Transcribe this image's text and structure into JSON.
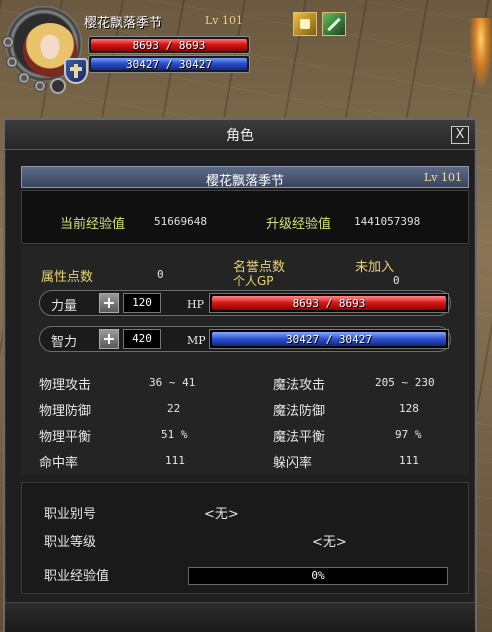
{
  "hud": {
    "name": "樱花飘落季节",
    "level": "Lv 101",
    "hp_text": "8693 / 8693",
    "mp_text": "30427 / 30427",
    "buffs": [
      "book-buff-icon",
      "sword-buff-icon"
    ]
  },
  "window": {
    "title": "角色",
    "close_label": "X",
    "char_name": "樱花飘落季节",
    "char_level": "Lv 101",
    "exp": {
      "current_label": "当前经验值",
      "current_value": "51669648",
      "next_label": "升级经验值",
      "next_value": "1441057398"
    },
    "attr_points_label": "属性点数",
    "attr_points_value": "0",
    "honor_label": "名誉点数",
    "honor_value": "未加入",
    "gp_label": "个人GP",
    "gp_value": "0",
    "str": {
      "label": "力量",
      "value": "120",
      "bar_label": "HP",
      "bar_text": "8693 / 8693",
      "fill": 1.0
    },
    "int": {
      "label": "智力",
      "value": "420",
      "bar_label": "MP",
      "bar_text": "30427 / 30427",
      "fill": 1.0
    },
    "combat_left": [
      {
        "label": "物理攻击",
        "value": "36 ~ 41"
      },
      {
        "label": "物理防御",
        "value": "22"
      },
      {
        "label": "物理平衡",
        "value": "51 %"
      },
      {
        "label": "命中率",
        "value": "111"
      }
    ],
    "combat_right": [
      {
        "label": "魔法攻击",
        "value": "205 ~ 230"
      },
      {
        "label": "魔法防御",
        "value": "128"
      },
      {
        "label": "魔法平衡",
        "value": "97 %"
      },
      {
        "label": "躲闪率",
        "value": "111"
      }
    ],
    "job": {
      "alias_label": "职业别号",
      "alias_value": "<无>",
      "level_label": "职业等级",
      "level_value": "<无>",
      "exp_label": "职业经验值",
      "exp_value": "0%",
      "exp_fill": 0
    }
  },
  "colors": {
    "hp": "#d91414",
    "mp": "#2a4fd0",
    "label_yellow": "#e8d470",
    "name_header": "#4a5670"
  }
}
